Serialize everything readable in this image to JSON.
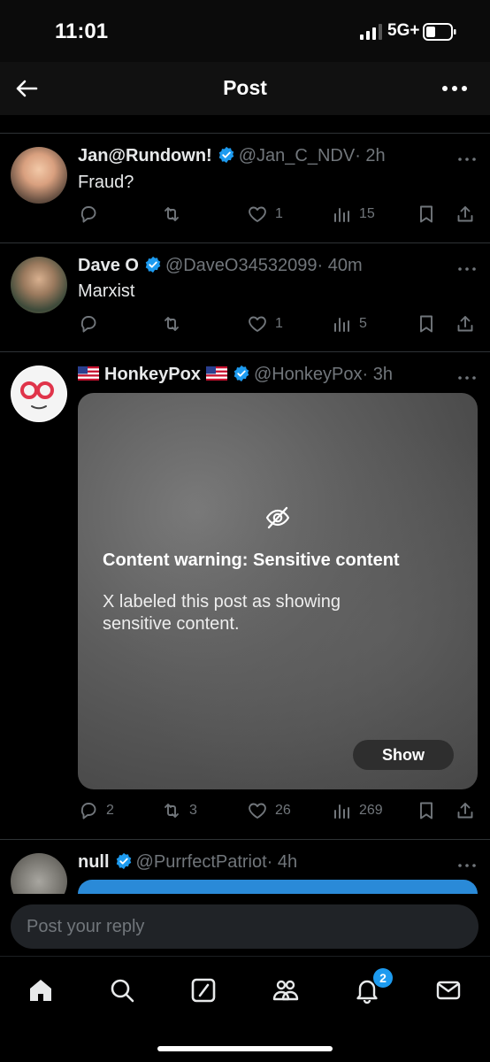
{
  "status_bar": {
    "time": "11:01",
    "network": "5G+"
  },
  "header": {
    "title": "Post"
  },
  "posts": [
    {
      "name": "Jan@Rundown!",
      "handle": "@Jan_C_NDV",
      "time": "· 2h",
      "text": "Fraud?",
      "replies": "",
      "reposts": "",
      "likes": "1",
      "views": "15"
    },
    {
      "name": "Dave O",
      "handle": "@DaveO34532099",
      "time": "· 40m",
      "text": "Marxist",
      "replies": "",
      "reposts": "",
      "likes": "1",
      "views": "5"
    },
    {
      "name": "HonkeyPox",
      "handle": "@HonkeyPox",
      "time": "· 3h",
      "text": "",
      "replies": "2",
      "reposts": "3",
      "likes": "26",
      "views": "269",
      "media": {
        "warning_title": "Content warning: Sensitive content",
        "warning_desc": "X labeled this post as showing sensitive content.",
        "show_label": "Show"
      }
    },
    {
      "name": "null",
      "handle": "@PurrfectPatriot",
      "time": "· 4h",
      "text": ""
    }
  ],
  "reply": {
    "placeholder": "Post your reply"
  },
  "tabbar": {
    "notifications_badge": "2"
  },
  "colors": {
    "background": "#000000",
    "accent": "#1d9bf0",
    "muted": "#71767b"
  },
  "icons": [
    "back-arrow-icon",
    "more-icon",
    "verified-icon",
    "us-flag-icon",
    "reply-icon",
    "repost-icon",
    "like-icon",
    "views-icon",
    "bookmark-icon",
    "share-icon",
    "eye-slash-icon",
    "home-icon",
    "search-icon",
    "grok-icon",
    "communities-icon",
    "notifications-icon",
    "messages-icon"
  ]
}
